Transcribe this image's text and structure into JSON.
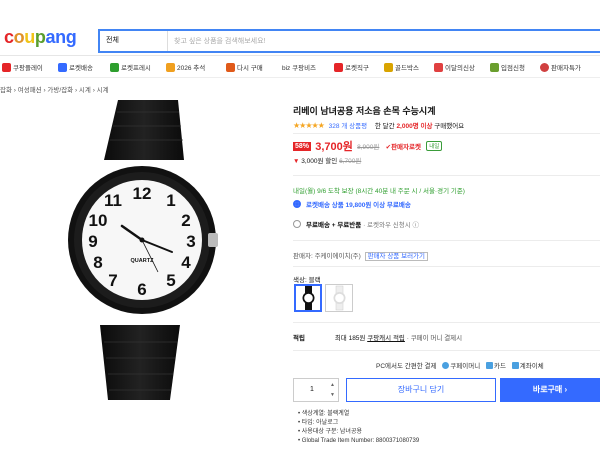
{
  "header": {
    "logo": "coupang",
    "search_category": "전체",
    "search_placeholder": "찾고 싶은 상품을 검색해보세요!"
  },
  "nav": {
    "items": [
      {
        "label": "쿠팡플레이",
        "color": "#e52528"
      },
      {
        "label": "로켓배송",
        "color": "#346aff"
      },
      {
        "label": "로켓프레시",
        "color": "#2e9e2e"
      },
      {
        "label": "2026 추석",
        "color": "#f0a020"
      },
      {
        "label": "다시 구매",
        "color": "#e05a1a"
      },
      {
        "label": "biz 쿠팡비즈",
        "color": "#2e9e2e"
      },
      {
        "label": "로켓직구",
        "color": "#e52528"
      },
      {
        "label": "골드박스",
        "color": "#d9a400"
      },
      {
        "label": "이달의신상",
        "color": "#e04040"
      },
      {
        "label": "입점신청",
        "color": "#6a9e2e"
      },
      {
        "label": "판매자특가",
        "color": "#d04040"
      }
    ]
  },
  "breadcrumb": "잡화 › 여성패션 › 가방/잡화 › 시계 › 시계",
  "product": {
    "title": "리베이 남녀공용 저소음 손목 수능시계",
    "stars": "★★★★★",
    "reviews": "328 개 상품평",
    "orders_prefix": "한 달간",
    "orders_count": "2,000명 이상",
    "orders_suffix": "구매했어요",
    "discount": "58%",
    "price": "3,700원",
    "original_price": "8,900원",
    "rocket_label": "✔판매자로켓",
    "badge": "내일",
    "coupon_amount": "3,000원 할인",
    "coupon_strike": "6,700원",
    "delivery": "내일(월) 9/6 도착 보장 (8시간 40분 내 주문 시 / 서울·경기 기준)",
    "option1_tag": "로켓배송 상품 19,800원 이상 무료배송",
    "option2_tag": "무료배송 + 무료반품",
    "option2_sub": "· 로켓와우 신청시 ⓘ",
    "seller_label": "판매자:",
    "seller_name": "주케이에이치(주)",
    "seller_btn": "판매자 상품 보러가기",
    "color_label": "색상: 블랙",
    "reward_label": "적립",
    "reward_amount": "최대 185원",
    "reward_link": "쿠팡캐시 적립",
    "reward_sub": "· 쿠페이 머니 결제시",
    "pc_text": "PC에서도 간편한 결제",
    "pay1": "쿠페이머니",
    "pay2": "카드",
    "pay3": "계좌이체",
    "qty": "1",
    "cart_btn": "장바구니 담기",
    "buy_btn": "바로구매 ›",
    "specs": [
      "색상계열: 블랙계열",
      "타입: 아날로그",
      "사용대상 구분: 남녀공용",
      "Global Trade Item Number: 8800371080739"
    ]
  },
  "colors": {
    "accent": "#346aff",
    "red": "#e52528"
  }
}
